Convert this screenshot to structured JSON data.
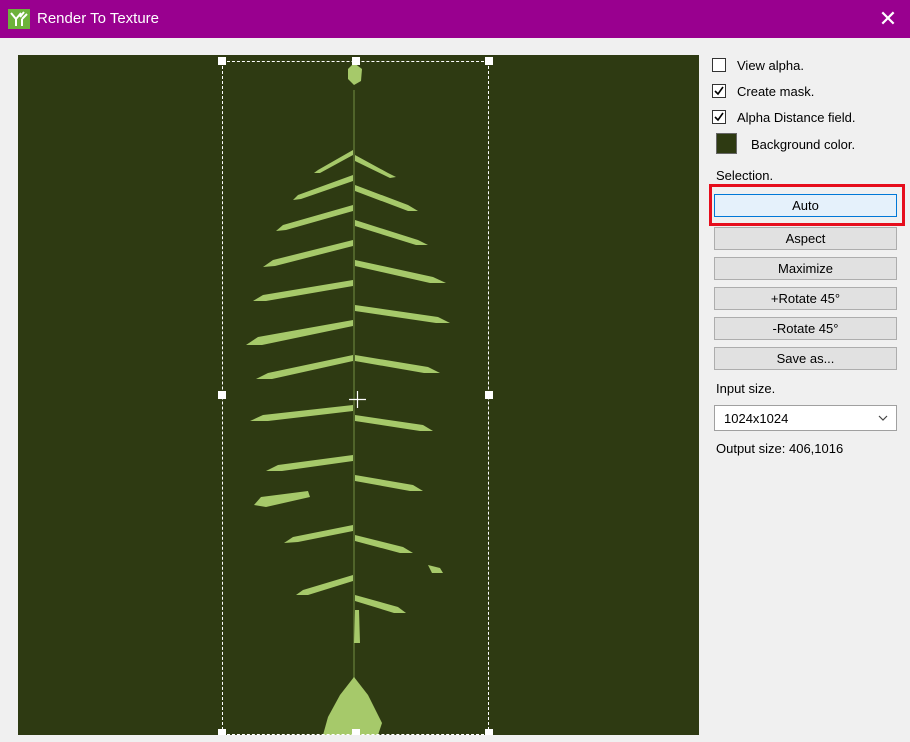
{
  "window": {
    "title": "Render To Texture",
    "close_glyph": "✕",
    "titlebar_color": "#99008f",
    "app_icon": "tree-app-icon"
  },
  "preview": {
    "background_color": "#2e3a12"
  },
  "options": {
    "view_alpha": {
      "label": "View alpha.",
      "checked": false
    },
    "create_mask": {
      "label": "Create mask.",
      "checked": true
    },
    "alpha_distance_field": {
      "label": "Alpha Distance field.",
      "checked": true
    },
    "background_color": {
      "label": "Background color.",
      "value": "#2e3a12"
    }
  },
  "selection": {
    "label": "Selection.",
    "buttons": [
      "Auto",
      "Aspect",
      "Maximize",
      "+Rotate 45°",
      "-Rotate 45°",
      "Save as..."
    ],
    "highlighted": "Auto",
    "highlight_color": "#e60d1c"
  },
  "input_size": {
    "label": "Input size.",
    "value": "1024x1024"
  },
  "output_size": {
    "text": "Output size: 406,1016"
  }
}
